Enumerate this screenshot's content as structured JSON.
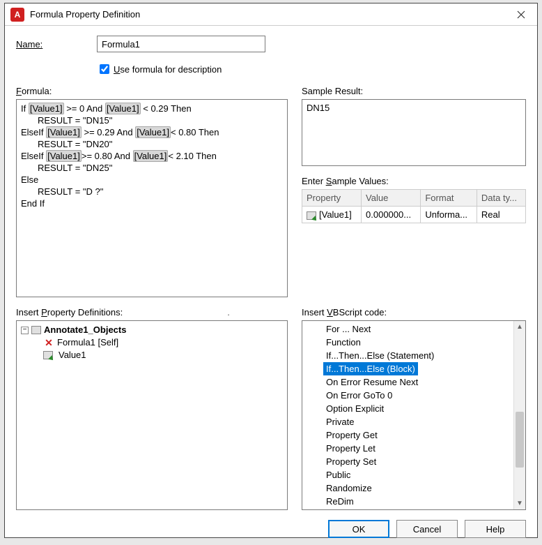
{
  "window": {
    "title": "Formula Property Definition",
    "app_icon_letter": "A"
  },
  "name": {
    "label_pre": "N",
    "label_rest": "ame:",
    "value": "Formula1"
  },
  "use_formula": {
    "checked": true,
    "label_pre": "U",
    "label_rest": "se formula for description"
  },
  "formula": {
    "label_pre": "F",
    "label_rest": "ormula:",
    "lines": [
      {
        "segments": [
          "If ",
          {
            "token": "[Value1]"
          },
          " >= 0 And ",
          {
            "token": "[Value1]"
          },
          " < 0.29 Then"
        ]
      },
      {
        "indent": 1,
        "segments": [
          "RESULT = \"DN15\""
        ]
      },
      {
        "segments": [
          "ElseIf ",
          {
            "token": "[Value1]"
          },
          " >= 0.29 And ",
          {
            "token": "[Value1]"
          },
          "< 0.80 Then"
        ]
      },
      {
        "indent": 1,
        "segments": [
          "RESULT = \"DN20\""
        ]
      },
      {
        "segments": [
          "ElseIf ",
          {
            "token": "[Value1]"
          },
          ">= 0.80 And ",
          {
            "token": "[Value1]"
          },
          "< 2.10 Then"
        ]
      },
      {
        "indent": 1,
        "segments": [
          "RESULT = \"DN25\""
        ]
      },
      {
        "segments": [
          "Else"
        ]
      },
      {
        "indent": 1,
        "segments": [
          "RESULT = \"D ?\""
        ]
      },
      {
        "segments": [
          "End If"
        ]
      }
    ]
  },
  "sample_result": {
    "label": "Sample Result:",
    "value": "DN15"
  },
  "sample_values": {
    "label_pre": "Enter ",
    "label_u": "S",
    "label_rest": "ample Values:",
    "headers": [
      "Property",
      "Value",
      "Format",
      "Data ty..."
    ],
    "rows": [
      {
        "property": "[Value1]",
        "value": "0.000000...",
        "format": "Unforma...",
        "datatype": "Real"
      }
    ]
  },
  "insert_props": {
    "label_pre": "Insert ",
    "label_u": "P",
    "label_rest": "roperty Definitions:",
    "root": "Annotate1_Objects",
    "children": [
      {
        "icon": "x",
        "label": "Formula1 [Self]"
      },
      {
        "icon": "doc",
        "label": "Value1"
      }
    ]
  },
  "insert_vb": {
    "label_pre": "Insert ",
    "label_u": "V",
    "label_rest": "BScript code:",
    "items": [
      "For ... Next",
      "Function",
      "If...Then...Else (Statement)",
      "If...Then...Else (Block)",
      "On Error Resume Next",
      "On Error GoTo 0",
      "Option Explicit",
      "Private",
      "Property Get",
      "Property Let",
      "Property Set",
      "Public",
      "Randomize",
      "ReDim"
    ],
    "selected_index": 3
  },
  "buttons": {
    "ok": "OK",
    "cancel": "Cancel",
    "help": "Help"
  }
}
